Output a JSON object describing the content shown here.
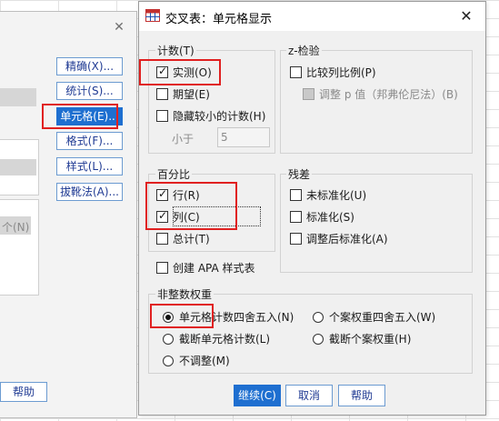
{
  "back_dialog": {
    "buttons": [
      {
        "label": "精确(X)...",
        "underline": "X"
      },
      {
        "label": "统计(S)...",
        "underline": "S"
      },
      {
        "label": "单元格(E)...",
        "underline": "E"
      },
      {
        "label": "格式(F)...",
        "underline": "F"
      },
      {
        "label": "样式(L)...",
        "underline": "L"
      },
      {
        "label": "拔靴法(A)...",
        "underline": "A"
      }
    ],
    "partial_label": "个(N)",
    "help_label": "帮助"
  },
  "dialog": {
    "title": "交叉表：单元格显示",
    "counts": {
      "title": "计数(T)",
      "items": [
        {
          "label": "实测(O)",
          "checked": true
        },
        {
          "label": "期望(E)",
          "checked": false
        },
        {
          "label": "隐藏较小的计数(H)",
          "checked": false
        }
      ],
      "less_than_label": "小于",
      "less_than_value": "5"
    },
    "ztest": {
      "title": "z-检验",
      "items": [
        {
          "label": "比较列比例(P)",
          "checked": false,
          "disabled": false
        },
        {
          "label": "调整 p 值（邦弗伦尼法）(B)",
          "checked": false,
          "disabled": true
        }
      ]
    },
    "percent": {
      "title": "百分比",
      "items": [
        {
          "label": "行(R)",
          "checked": true
        },
        {
          "label": "列(C)",
          "checked": true
        },
        {
          "label": "总计(T)",
          "checked": false
        }
      ]
    },
    "residuals": {
      "title": "残差",
      "items": [
        {
          "label": "未标准化(U)",
          "checked": false
        },
        {
          "label": "标准化(S)",
          "checked": false
        },
        {
          "label": "调整后标准化(A)",
          "checked": false
        }
      ]
    },
    "apa": {
      "label": "创建 APA 样式表",
      "checked": false
    },
    "noninteger": {
      "title": "非整数权重",
      "options": [
        {
          "label": "单元格计数四舍五入(N)",
          "selected": true
        },
        {
          "label": "个案权重四舍五入(W)",
          "selected": false
        },
        {
          "label": "截断单元格计数(L)",
          "selected": false
        },
        {
          "label": "截断个案权重(H)",
          "selected": false
        },
        {
          "label": "不调整(M)",
          "selected": false
        }
      ]
    },
    "buttons": {
      "continue": "继续(C)",
      "cancel": "取消",
      "help": "帮助"
    }
  },
  "colors": {
    "accent": "#1e6fd0",
    "highlight_box": "#e02020",
    "button_text": "#1f3a93"
  }
}
